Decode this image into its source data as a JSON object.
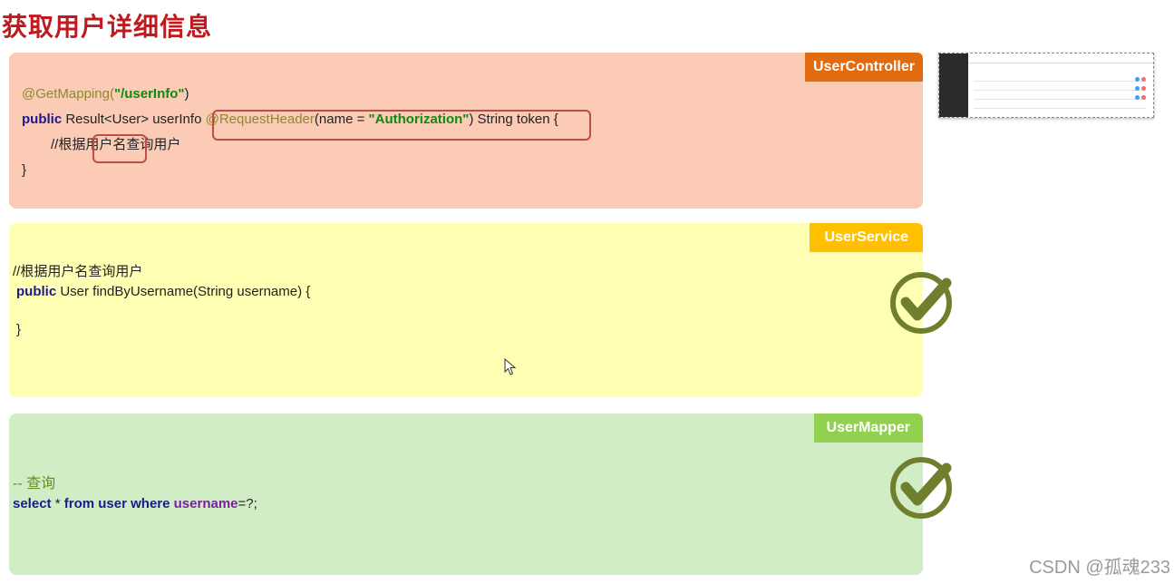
{
  "page": {
    "title": "获取用户详细信息",
    "watermark": "CSDN @孤魂233"
  },
  "controller": {
    "tag": "UserController",
    "line1_annotation": "@GetMapping(",
    "line1_string": "\"/userInfo\"",
    "line1_close": ")",
    "line2_public": "public",
    "line2_sig": " Result<User> userInfo",
    "line2_ann": "@RequestHeader",
    "line2_name": "(name = ",
    "line2_str": "\"Authorization\"",
    "line2_tail": ") String token",
    "line2_brace": " {",
    "line3_prefix": "//根据",
    "line3_highlight": "用户名",
    "line3_suffix": "查询用户",
    "line4": "}"
  },
  "service": {
    "tag": "UserService",
    "comment": "//根据用户名查询用户",
    "line_public": "public",
    "line_sig": " User findByUsername(String username) {",
    "close": "}"
  },
  "mapper": {
    "tag": "UserMapper",
    "comment": "-- 查询",
    "kw_select": "select",
    "star": " * ",
    "kw_from": "from",
    "table": " user ",
    "kw_where": "where",
    "field": " username",
    "tail": "=?;"
  },
  "colors": {
    "title": "#c0191f",
    "controller_bg": "#fccbb6",
    "controller_tag": "#e26b10",
    "service_bg": "#ffffb3",
    "service_tag": "#ffc000",
    "mapper_bg": "#d0edc6",
    "mapper_tag": "#92d050",
    "check": "#6f7f2d"
  },
  "icons": [
    "check-circle-icon",
    "mouse-cursor-icon"
  ]
}
